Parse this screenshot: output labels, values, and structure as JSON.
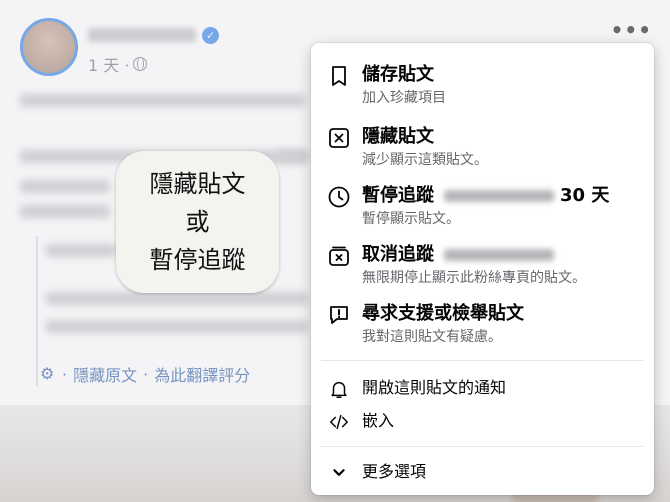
{
  "post": {
    "time_text": "1 天 ·",
    "more_label": "•••",
    "translate": {
      "hide_original": "隱藏原文",
      "sep1": "·",
      "rate": "為此翻譯評分",
      "lead_sep": "·"
    }
  },
  "callout": {
    "line1": "隱藏貼文",
    "line2": "或",
    "line3": "暫停追蹤"
  },
  "menu": {
    "items": [
      {
        "title": "儲存貼文",
        "subtitle": "加入珍藏項目",
        "icon": "bookmark-icon"
      },
      {
        "title": "隱藏貼文",
        "subtitle": "減少顯示這類貼文。",
        "icon": "hide-x-icon"
      },
      {
        "title_prefix": "暫停追蹤",
        "title_suffix": "30 天",
        "subtitle": "暫停顯示貼文。",
        "icon": "clock-icon"
      },
      {
        "title_prefix": "取消追蹤",
        "subtitle": "無限期停止顯示此粉絲專頁的貼文。",
        "icon": "unfollow-icon"
      },
      {
        "title": "尋求支援或檢舉貼文",
        "subtitle": "我對這則貼文有疑慮。",
        "icon": "report-icon"
      }
    ],
    "notify_label": "開啟這則貼文的通知",
    "embed_label": "嵌入",
    "more_options_label": "更多選項"
  }
}
